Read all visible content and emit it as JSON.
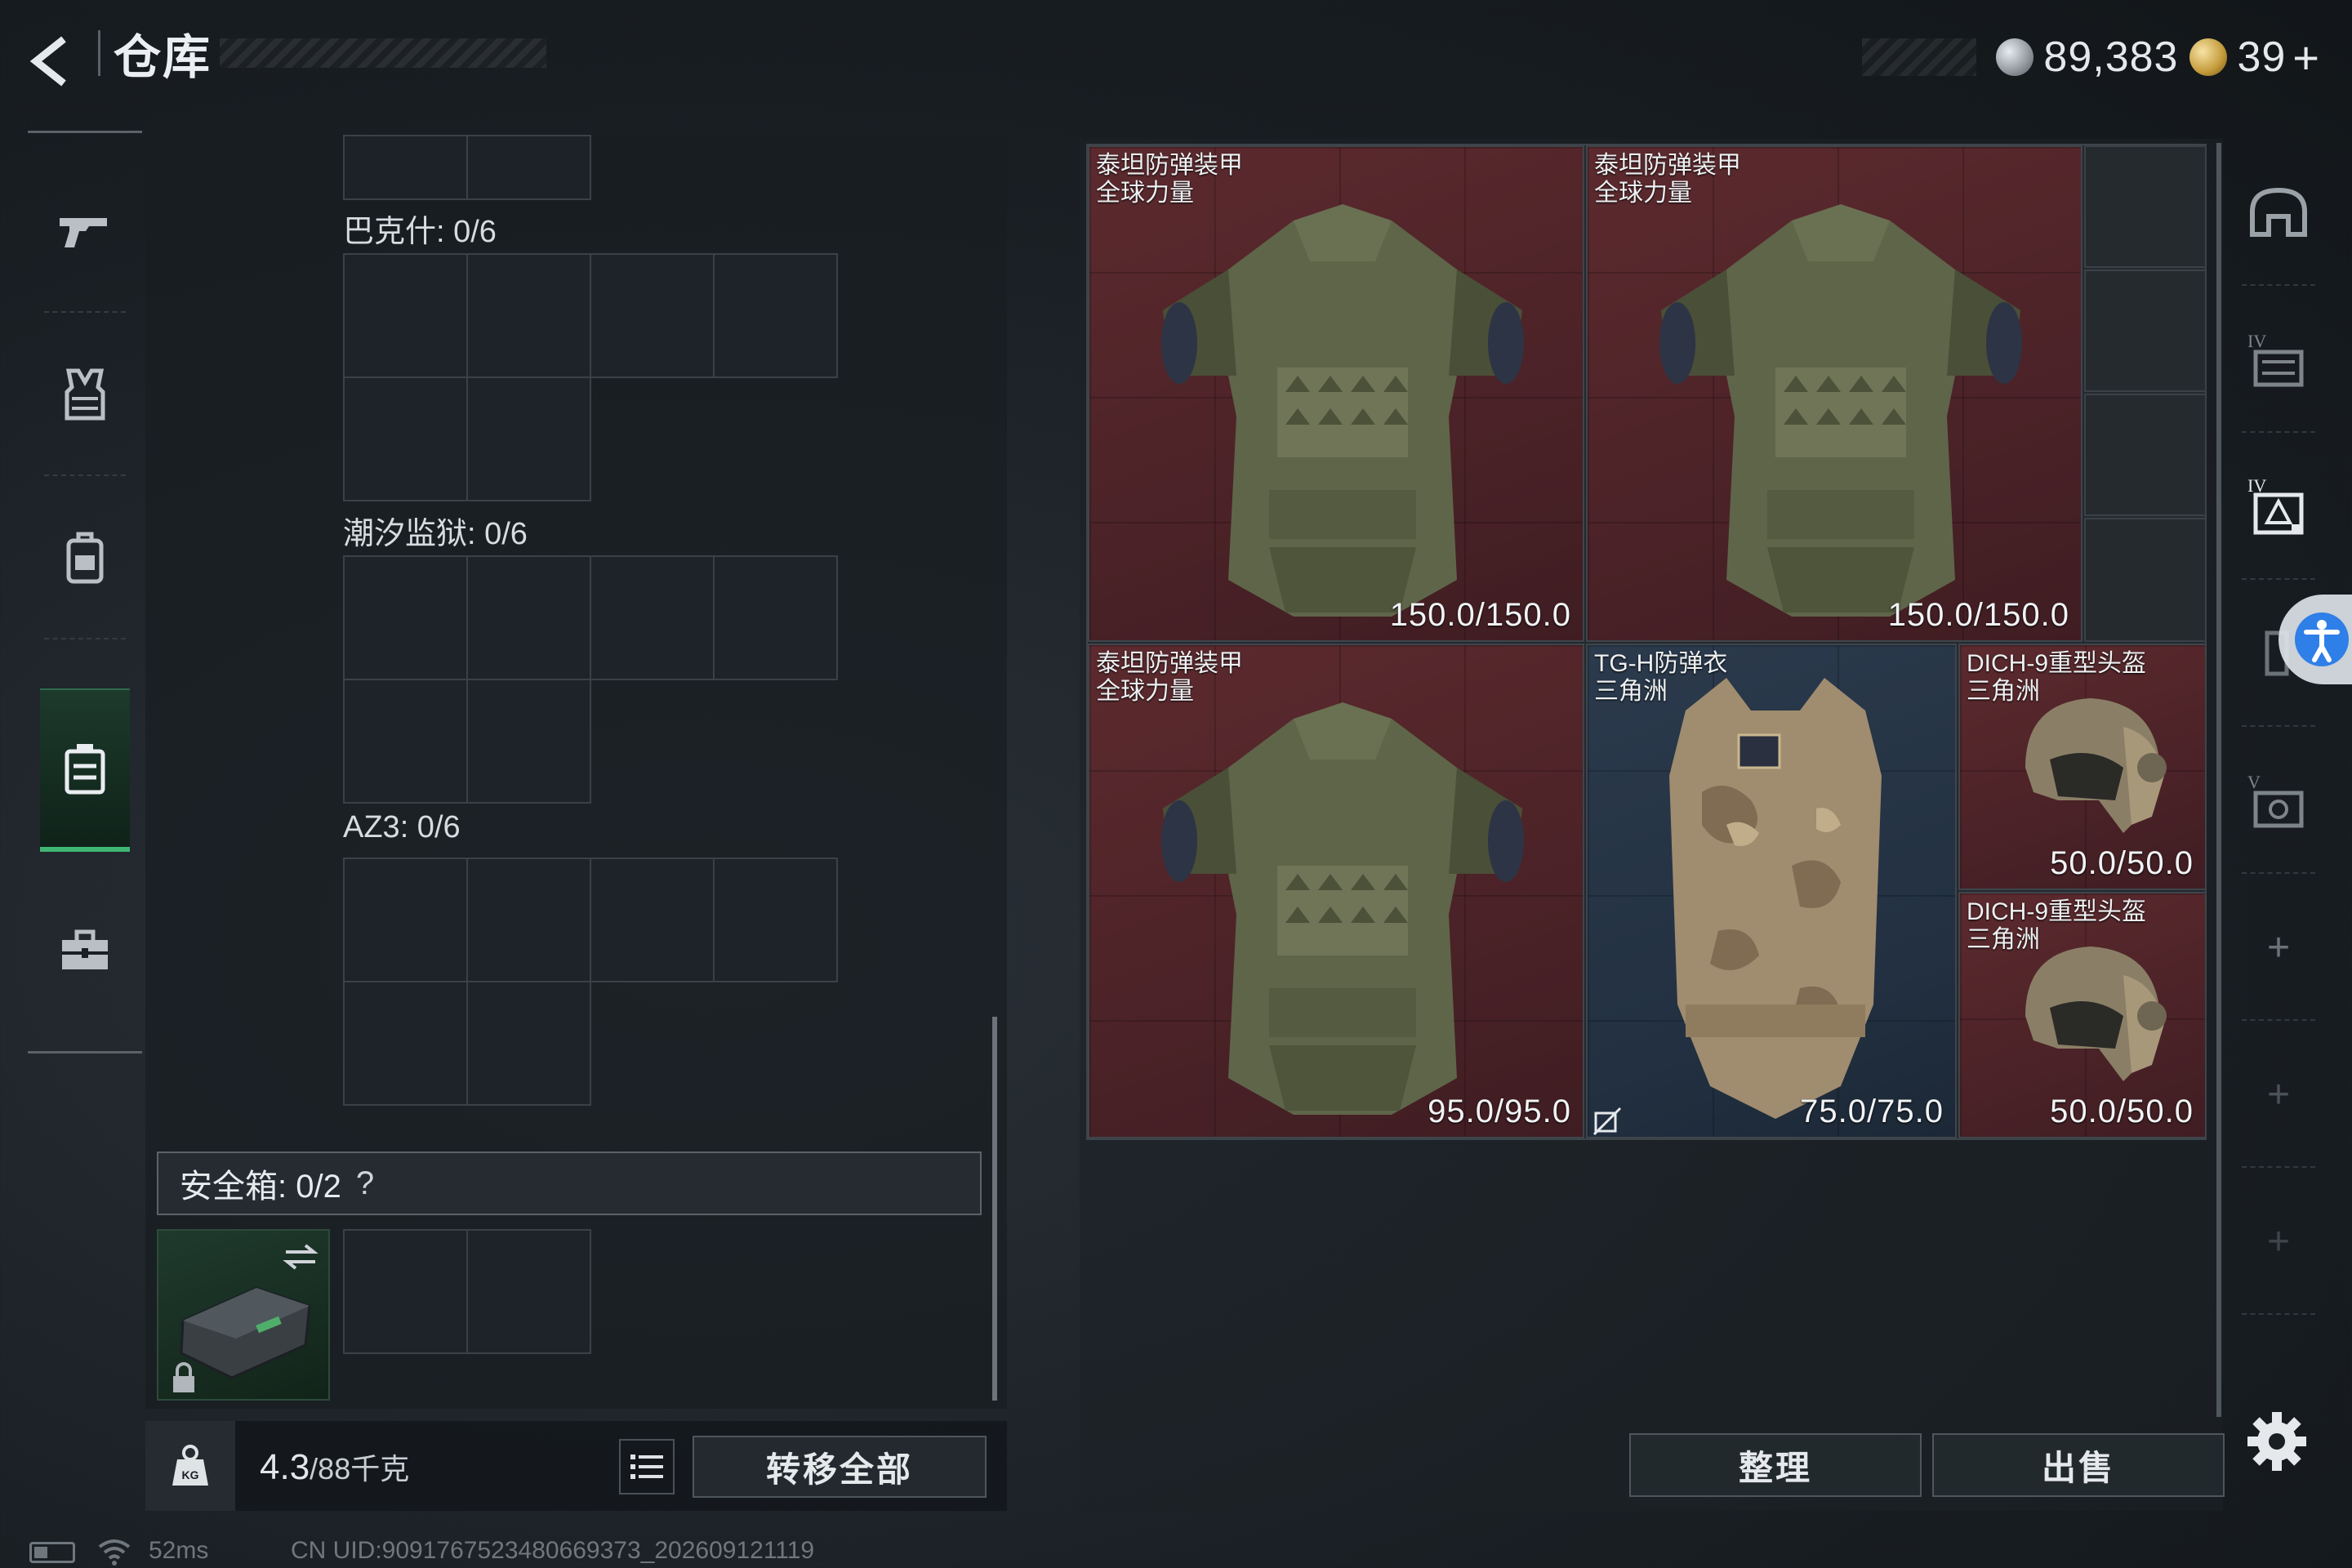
{
  "header": {
    "title": "仓库",
    "currency_silver": "89,383",
    "currency_gold": "39",
    "currency_plus": "+"
  },
  "left_nav": {
    "items": [
      "weapon-icon",
      "vest-icon",
      "backpack-icon",
      "storage-case-icon",
      "toolbox-icon"
    ],
    "active_index": 3
  },
  "storage_groups": [
    {
      "label": "巴克什: 0/6"
    },
    {
      "label": "潮汐监狱: 0/6"
    },
    {
      "label": "AZ3: 0/6"
    }
  ],
  "safebox": {
    "label": "安全箱:  0/2",
    "help": "?"
  },
  "footer_left": {
    "weight_value": "4.3",
    "weight_total": "/88千克",
    "transfer_all": "转移全部"
  },
  "items": [
    {
      "name_line1": "泰坦防弹装甲",
      "name_line2": "全球力量",
      "durability": "150.0/150.0",
      "rarity_color": "#5c2a2e"
    },
    {
      "name_line1": "泰坦防弹装甲",
      "name_line2": "全球力量",
      "durability": "150.0/150.0",
      "rarity_color": "#5c2a2e"
    },
    {
      "name_line1": "泰坦防弹装甲",
      "name_line2": "全球力量",
      "durability": "95.0/95.0",
      "rarity_color": "#5c2a2e"
    },
    {
      "name_line1": "TG-H防弹衣",
      "name_line2": "三角洲",
      "durability": "75.0/75.0",
      "rarity_color": "#2b3a4c"
    },
    {
      "name_line1": "DICH-9重型头盔",
      "name_line2": "三角洲",
      "durability": "50.0/50.0",
      "rarity_color": "#5c2a2e"
    },
    {
      "name_line1": "DICH-9重型头盔",
      "name_line2": "三角洲",
      "durability": "50.0/50.0",
      "rarity_color": "#5c2a2e"
    }
  ],
  "right_nav": {
    "items": [
      "helmet-slot-icon",
      "armor-iv-icon",
      "armor-iv-active-icon",
      "armor-slot-icon",
      "armor-v-icon",
      "add-icon",
      "add-icon",
      "add-icon"
    ],
    "plus": "+"
  },
  "footer_right": {
    "sort": "整理",
    "sell": "出售"
  },
  "status": {
    "ping": "52ms",
    "uid": "CN UID:9091767523480669373_202609121119"
  }
}
